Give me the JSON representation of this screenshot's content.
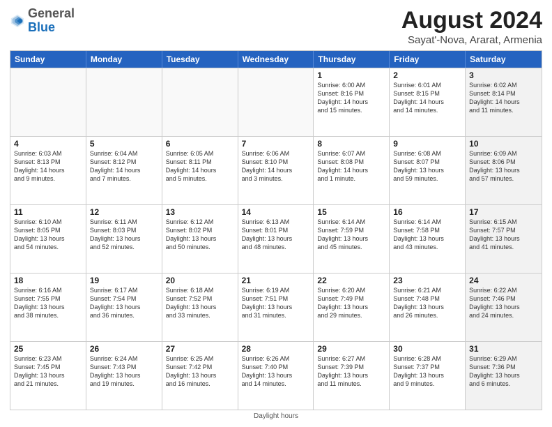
{
  "header": {
    "logo_general": "General",
    "logo_blue": "Blue",
    "title": "August 2024",
    "subtitle": "Sayat'-Nova, Ararat, Armenia"
  },
  "days": [
    "Sunday",
    "Monday",
    "Tuesday",
    "Wednesday",
    "Thursday",
    "Friday",
    "Saturday"
  ],
  "weeks": [
    [
      {
        "day": "",
        "text": "",
        "empty": true
      },
      {
        "day": "",
        "text": "",
        "empty": true
      },
      {
        "day": "",
        "text": "",
        "empty": true
      },
      {
        "day": "",
        "text": "",
        "empty": true
      },
      {
        "day": "1",
        "text": "Sunrise: 6:00 AM\nSunset: 8:16 PM\nDaylight: 14 hours\nand 15 minutes.",
        "empty": false
      },
      {
        "day": "2",
        "text": "Sunrise: 6:01 AM\nSunset: 8:15 PM\nDaylight: 14 hours\nand 14 minutes.",
        "empty": false
      },
      {
        "day": "3",
        "text": "Sunrise: 6:02 AM\nSunset: 8:14 PM\nDaylight: 14 hours\nand 11 minutes.",
        "empty": false,
        "shaded": true
      }
    ],
    [
      {
        "day": "4",
        "text": "Sunrise: 6:03 AM\nSunset: 8:13 PM\nDaylight: 14 hours\nand 9 minutes.",
        "empty": false
      },
      {
        "day": "5",
        "text": "Sunrise: 6:04 AM\nSunset: 8:12 PM\nDaylight: 14 hours\nand 7 minutes.",
        "empty": false
      },
      {
        "day": "6",
        "text": "Sunrise: 6:05 AM\nSunset: 8:11 PM\nDaylight: 14 hours\nand 5 minutes.",
        "empty": false
      },
      {
        "day": "7",
        "text": "Sunrise: 6:06 AM\nSunset: 8:10 PM\nDaylight: 14 hours\nand 3 minutes.",
        "empty": false
      },
      {
        "day": "8",
        "text": "Sunrise: 6:07 AM\nSunset: 8:08 PM\nDaylight: 14 hours\nand 1 minute.",
        "empty": false
      },
      {
        "day": "9",
        "text": "Sunrise: 6:08 AM\nSunset: 8:07 PM\nDaylight: 13 hours\nand 59 minutes.",
        "empty": false
      },
      {
        "day": "10",
        "text": "Sunrise: 6:09 AM\nSunset: 8:06 PM\nDaylight: 13 hours\nand 57 minutes.",
        "empty": false,
        "shaded": true
      }
    ],
    [
      {
        "day": "11",
        "text": "Sunrise: 6:10 AM\nSunset: 8:05 PM\nDaylight: 13 hours\nand 54 minutes.",
        "empty": false
      },
      {
        "day": "12",
        "text": "Sunrise: 6:11 AM\nSunset: 8:03 PM\nDaylight: 13 hours\nand 52 minutes.",
        "empty": false
      },
      {
        "day": "13",
        "text": "Sunrise: 6:12 AM\nSunset: 8:02 PM\nDaylight: 13 hours\nand 50 minutes.",
        "empty": false
      },
      {
        "day": "14",
        "text": "Sunrise: 6:13 AM\nSunset: 8:01 PM\nDaylight: 13 hours\nand 48 minutes.",
        "empty": false
      },
      {
        "day": "15",
        "text": "Sunrise: 6:14 AM\nSunset: 7:59 PM\nDaylight: 13 hours\nand 45 minutes.",
        "empty": false
      },
      {
        "day": "16",
        "text": "Sunrise: 6:14 AM\nSunset: 7:58 PM\nDaylight: 13 hours\nand 43 minutes.",
        "empty": false
      },
      {
        "day": "17",
        "text": "Sunrise: 6:15 AM\nSunset: 7:57 PM\nDaylight: 13 hours\nand 41 minutes.",
        "empty": false,
        "shaded": true
      }
    ],
    [
      {
        "day": "18",
        "text": "Sunrise: 6:16 AM\nSunset: 7:55 PM\nDaylight: 13 hours\nand 38 minutes.",
        "empty": false
      },
      {
        "day": "19",
        "text": "Sunrise: 6:17 AM\nSunset: 7:54 PM\nDaylight: 13 hours\nand 36 minutes.",
        "empty": false
      },
      {
        "day": "20",
        "text": "Sunrise: 6:18 AM\nSunset: 7:52 PM\nDaylight: 13 hours\nand 33 minutes.",
        "empty": false
      },
      {
        "day": "21",
        "text": "Sunrise: 6:19 AM\nSunset: 7:51 PM\nDaylight: 13 hours\nand 31 minutes.",
        "empty": false
      },
      {
        "day": "22",
        "text": "Sunrise: 6:20 AM\nSunset: 7:49 PM\nDaylight: 13 hours\nand 29 minutes.",
        "empty": false
      },
      {
        "day": "23",
        "text": "Sunrise: 6:21 AM\nSunset: 7:48 PM\nDaylight: 13 hours\nand 26 minutes.",
        "empty": false
      },
      {
        "day": "24",
        "text": "Sunrise: 6:22 AM\nSunset: 7:46 PM\nDaylight: 13 hours\nand 24 minutes.",
        "empty": false,
        "shaded": true
      }
    ],
    [
      {
        "day": "25",
        "text": "Sunrise: 6:23 AM\nSunset: 7:45 PM\nDaylight: 13 hours\nand 21 minutes.",
        "empty": false
      },
      {
        "day": "26",
        "text": "Sunrise: 6:24 AM\nSunset: 7:43 PM\nDaylight: 13 hours\nand 19 minutes.",
        "empty": false
      },
      {
        "day": "27",
        "text": "Sunrise: 6:25 AM\nSunset: 7:42 PM\nDaylight: 13 hours\nand 16 minutes.",
        "empty": false
      },
      {
        "day": "28",
        "text": "Sunrise: 6:26 AM\nSunset: 7:40 PM\nDaylight: 13 hours\nand 14 minutes.",
        "empty": false
      },
      {
        "day": "29",
        "text": "Sunrise: 6:27 AM\nSunset: 7:39 PM\nDaylight: 13 hours\nand 11 minutes.",
        "empty": false
      },
      {
        "day": "30",
        "text": "Sunrise: 6:28 AM\nSunset: 7:37 PM\nDaylight: 13 hours\nand 9 minutes.",
        "empty": false
      },
      {
        "day": "31",
        "text": "Sunrise: 6:29 AM\nSunset: 7:36 PM\nDaylight: 13 hours\nand 6 minutes.",
        "empty": false,
        "shaded": true
      }
    ]
  ],
  "footer": "Daylight hours"
}
